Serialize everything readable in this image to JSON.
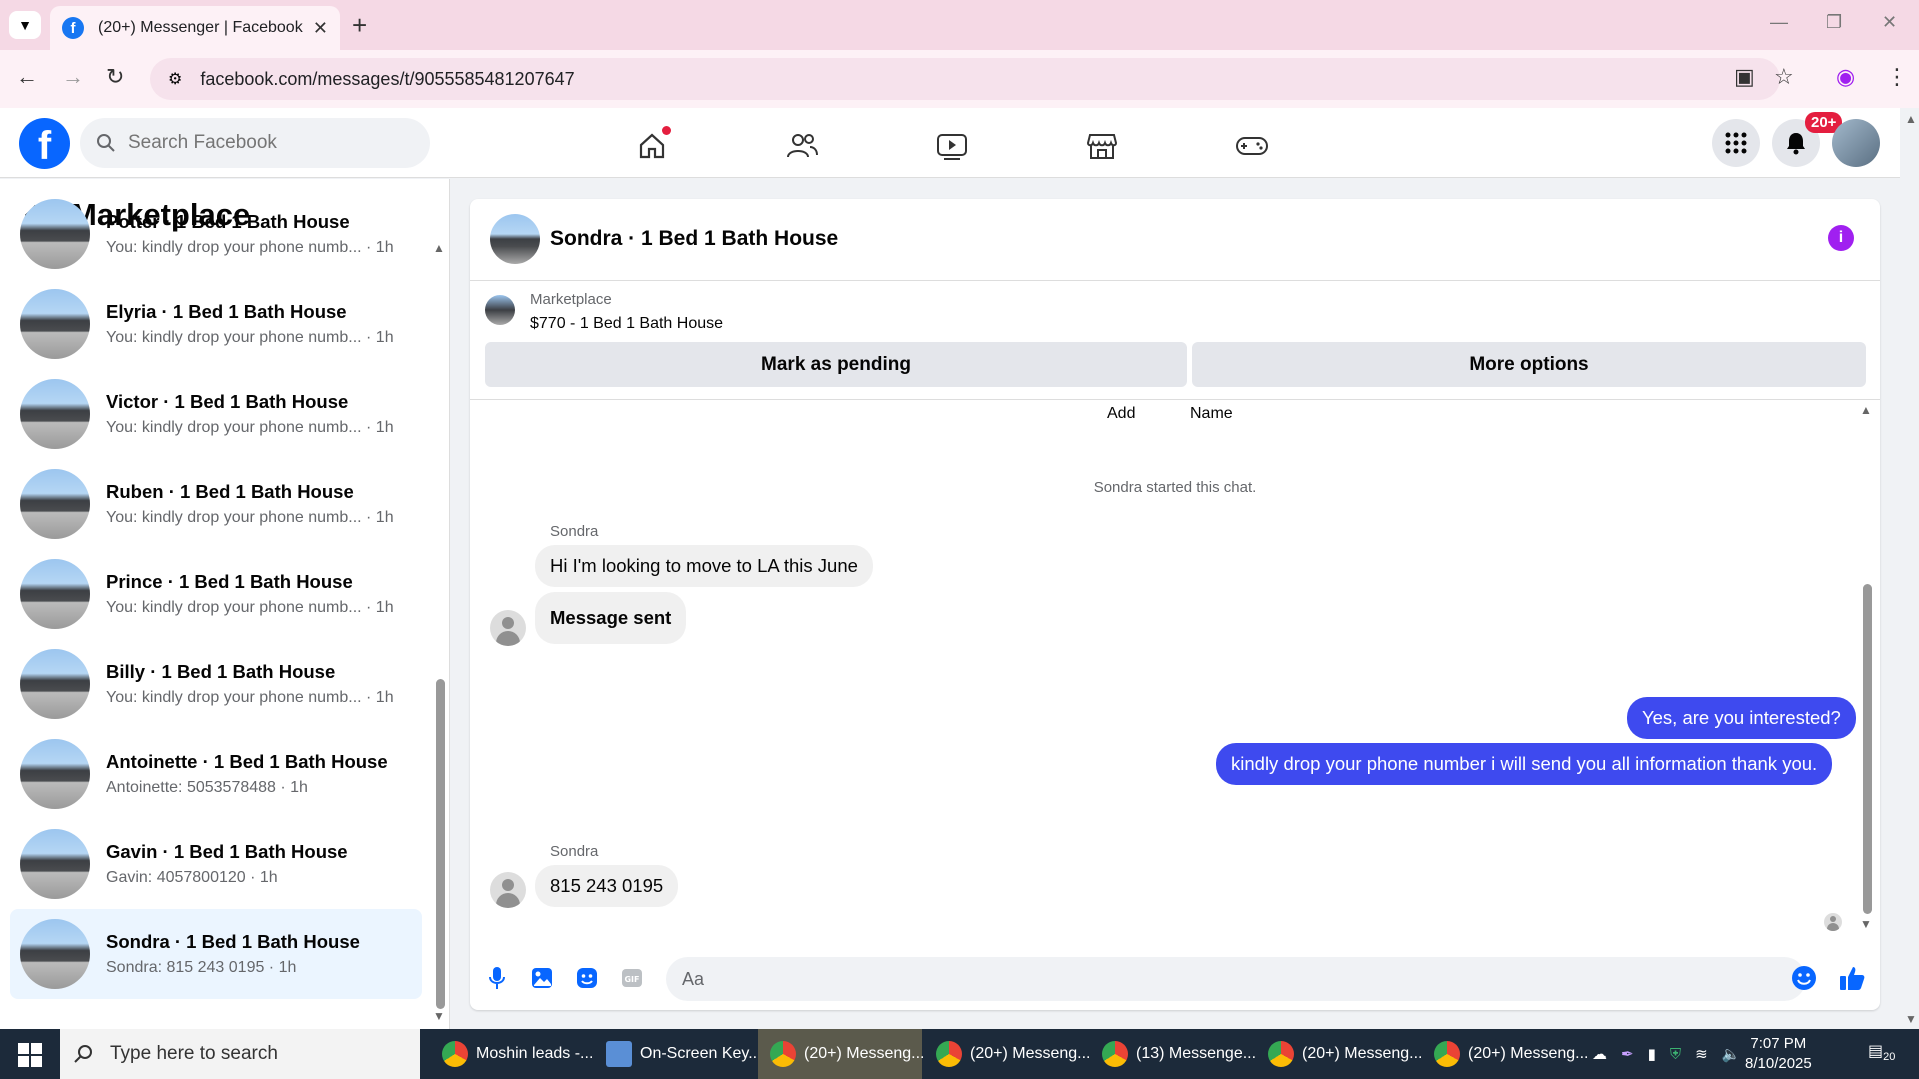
{
  "browser": {
    "tab_title": "(20+) Messenger | Facebook",
    "url": "facebook.com/messages/t/9055585481207647"
  },
  "fb": {
    "search_placeholder": "Search Facebook",
    "notif_badge": "20+"
  },
  "sidebar": {
    "title": "Marketplace",
    "conversations": [
      {
        "name": "Potter · 1 Bed 1 Bath House",
        "preview": "You: kindly drop your phone numb... · 1h"
      },
      {
        "name": "Elyria · 1 Bed 1 Bath House",
        "preview": "You: kindly drop your phone numb... · 1h"
      },
      {
        "name": "Victor · 1 Bed 1 Bath House",
        "preview": "You: kindly drop your phone numb... · 1h"
      },
      {
        "name": "Ruben · 1 Bed 1 Bath House",
        "preview": "You: kindly drop your phone numb... · 1h"
      },
      {
        "name": "Prince · 1 Bed 1 Bath House",
        "preview": "You: kindly drop your phone numb... · 1h"
      },
      {
        "name": "Billy · 1 Bed 1 Bath House",
        "preview": "You: kindly drop your phone numb... · 1h"
      },
      {
        "name": "Antoinette · 1 Bed 1 Bath House",
        "preview": "Antoinette: 5053578488 · 1h"
      },
      {
        "name": "Gavin · 1 Bed 1 Bath House",
        "preview": "Gavin: 4057800120 · 1h"
      },
      {
        "name": "Sondra · 1 Bed 1 Bath House",
        "preview": "Sondra: 815 243 0195 · 1h"
      }
    ]
  },
  "chat": {
    "title": "Sondra · 1 Bed 1 Bath House",
    "listing_source": "Marketplace",
    "listing_title": "$770 - 1 Bed 1 Bath House",
    "btn_pending": "Mark as pending",
    "btn_more": "More options",
    "top_add": "Add",
    "top_name": "Name",
    "system_msg": "Sondra started this chat.",
    "sender_1": "Sondra",
    "msg_in_1": "Hi I'm looking to move to LA this June",
    "msg_in_2": "Message sent",
    "msg_out_1": "Yes, are you interested?",
    "msg_out_2": "kindly drop your phone number i will send you all information thank you.",
    "sender_2": "Sondra",
    "msg_in_3": "815 243 0195",
    "composer_placeholder": "Aa"
  },
  "taskbar": {
    "search_placeholder": "Type here to search",
    "apps": [
      "Moshin leads -...",
      "On-Screen Key...",
      "(20+) Messeng...",
      "(20+) Messeng...",
      "(13) Messenge...",
      "(20+) Messeng...",
      "(20+) Messeng..."
    ],
    "time": "7:07 PM",
    "date": "8/10/2025",
    "notif_count": "20"
  },
  "colors": {
    "fb_blue": "#0866ff",
    "outgoing_bubble": "#3e4aef",
    "info_purple": "#a020f0",
    "badge_red": "#e41e3f"
  }
}
